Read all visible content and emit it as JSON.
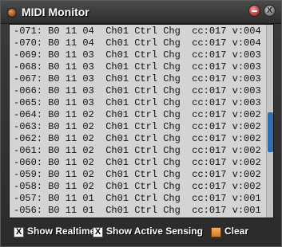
{
  "window": {
    "title": "MIDI Monitor",
    "minimize_icon": "minimize-icon",
    "close_icon": "close-icon",
    "close_glyph": "X"
  },
  "log": {
    "lines": [
      "-071: B0 11 04  Ch01 Ctrl Chg  cc:017 v:004",
      "-070: B0 11 04  Ch01 Ctrl Chg  cc:017 v:004",
      "-069: B0 11 03  Ch01 Ctrl Chg  cc:017 v:003",
      "-068: B0 11 03  Ch01 Ctrl Chg  cc:017 v:003",
      "-067: B0 11 03  Ch01 Ctrl Chg  cc:017 v:003",
      "-066: B0 11 03  Ch01 Ctrl Chg  cc:017 v:003",
      "-065: B0 11 03  Ch01 Ctrl Chg  cc:017 v:003",
      "-064: B0 11 02  Ch01 Ctrl Chg  cc:017 v:002",
      "-063: B0 11 02  Ch01 Ctrl Chg  cc:017 v:002",
      "-062: B0 11 02  Ch01 Ctrl Chg  cc:017 v:002",
      "-061: B0 11 02  Ch01 Ctrl Chg  cc:017 v:002",
      "-060: B0 11 02  Ch01 Ctrl Chg  cc:017 v:002",
      "-059: B0 11 02  Ch01 Ctrl Chg  cc:017 v:002",
      "-058: B0 11 02  Ch01 Ctrl Chg  cc:017 v:002",
      "-057: B0 11 01  Ch01 Ctrl Chg  cc:017 v:001",
      "-056: B0 11 01  Ch01 Ctrl Chg  cc:017 v:001"
    ]
  },
  "options": {
    "show_realtime": {
      "label": "Show Realtime",
      "checked": true,
      "mark": "X"
    },
    "show_active_sensing": {
      "label": "Show Active Sensing",
      "checked": true,
      "mark": "X"
    },
    "clear": {
      "label": "Clear"
    }
  },
  "colors": {
    "log_background": "#d4d4d4",
    "scroll_thumb": "#2c6fb4",
    "clear_button": "#e89a40"
  }
}
